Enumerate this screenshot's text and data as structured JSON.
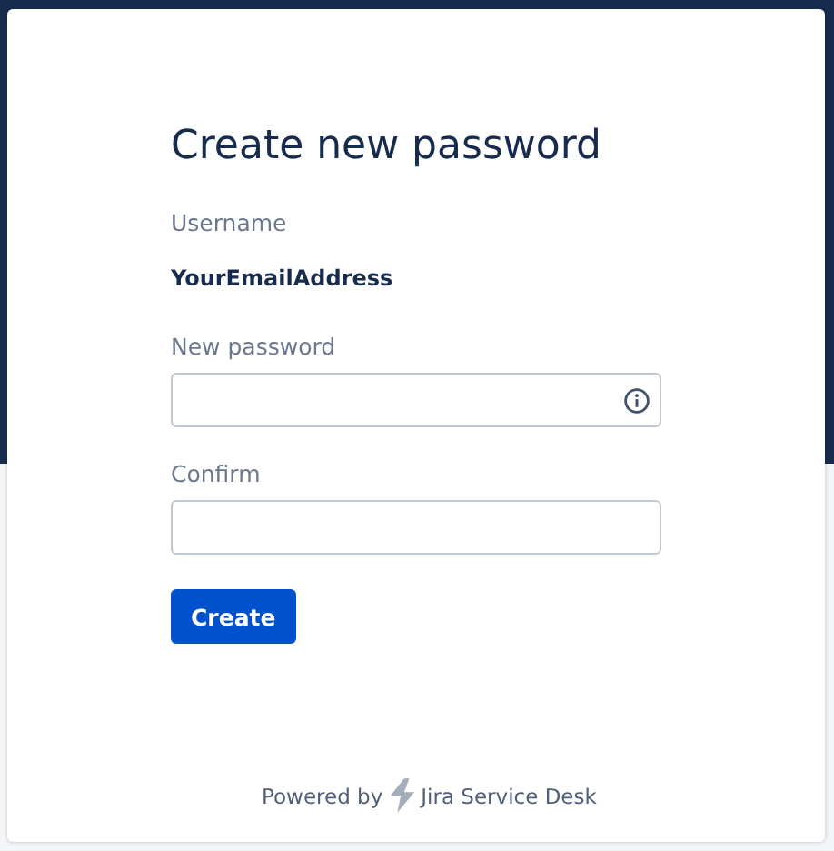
{
  "form": {
    "title": "Create new password",
    "username": {
      "label": "Username",
      "value": "YourEmailAddress"
    },
    "fields": [
      {
        "label": "New password",
        "kind": "password-info"
      },
      {
        "label": "Confirm",
        "kind": "password"
      }
    ],
    "submit": "Create"
  },
  "footer": {
    "prefix": "Powered by",
    "product": "Jira Service Desk"
  }
}
